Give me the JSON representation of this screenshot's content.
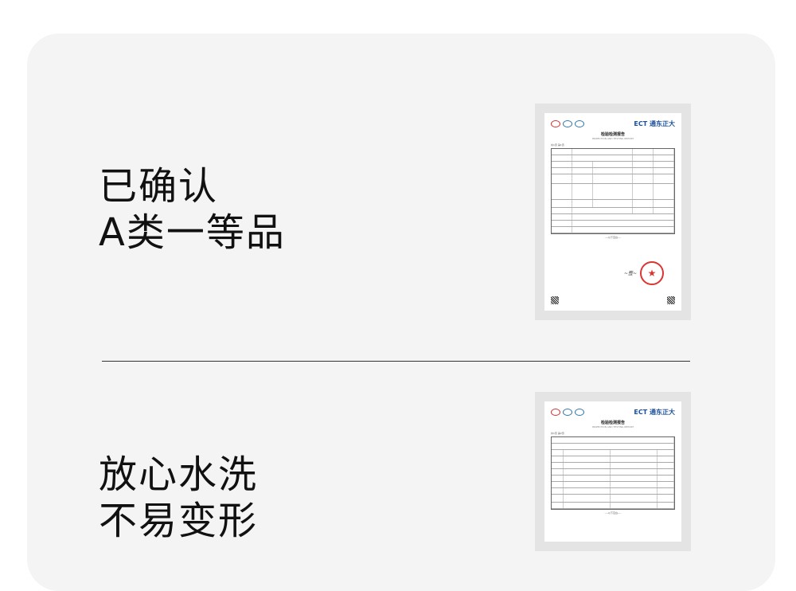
{
  "section1": {
    "line1": "已确认",
    "line2": "A类一等品"
  },
  "section2": {
    "line1": "放心水洗",
    "line2": "不易变形"
  },
  "report": {
    "logo": "ECT 通东正大",
    "title": "检验检测报告",
    "subtitle": "INSPECTION AND TESTING REPORT",
    "page1": "共1页 第1页",
    "page2": "共1页 第2页",
    "end_mark": "----以下空白----",
    "stamp_mark": "★"
  }
}
